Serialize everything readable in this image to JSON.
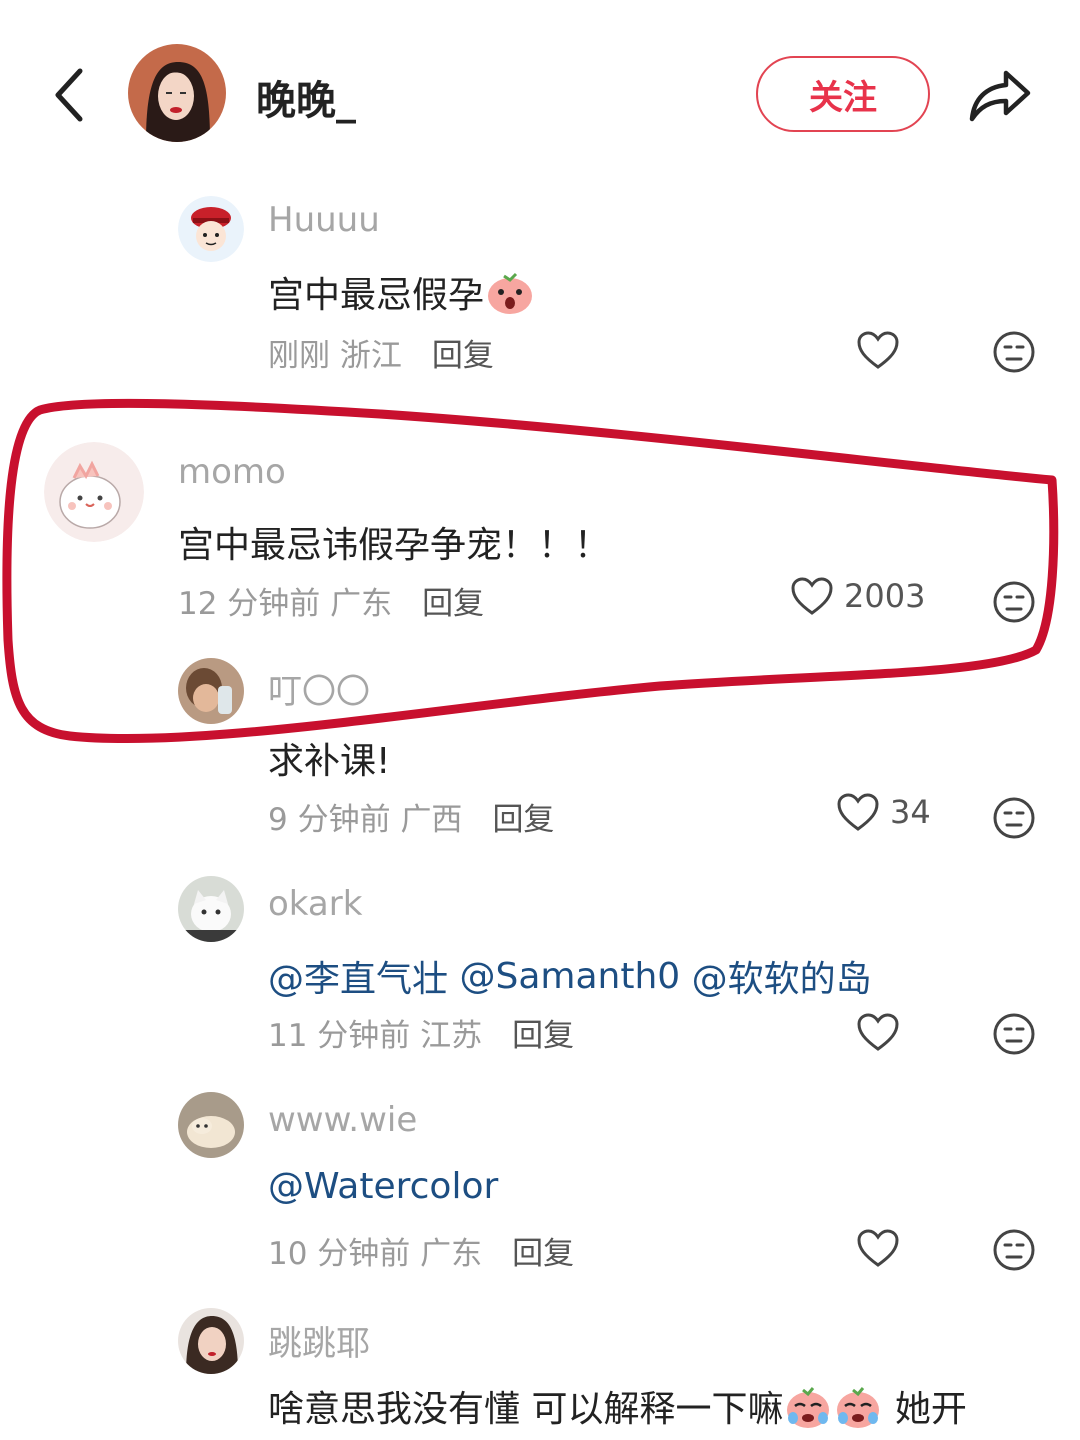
{
  "header": {
    "author_name": "晚晚_",
    "follow_label": "关注"
  },
  "comments": [
    {
      "user": "Huuuu",
      "text": "宫中最忌假孕",
      "time": "刚刚",
      "location": "浙江",
      "reply": "回复",
      "likes": ""
    },
    {
      "user": "momo",
      "text": "宫中最忌讳假孕争宠！！！",
      "time": "12 分钟前",
      "location": "广东",
      "reply": "回复",
      "likes": "2003"
    },
    {
      "user": "叮〇〇",
      "text": "求补课!",
      "time": "9 分钟前",
      "location": "广西",
      "reply": "回复",
      "likes": "34"
    },
    {
      "user": "okark",
      "mentions": [
        "@李直气壮",
        "@Samanth0",
        "@软软的岛"
      ],
      "time": "11 分钟前",
      "location": "江苏",
      "reply": "回复",
      "likes": ""
    },
    {
      "user": "www.wie",
      "mentions": [
        "@Watercolor"
      ],
      "time": "10 分钟前",
      "location": "广东",
      "reply": "回复",
      "likes": ""
    },
    {
      "user": "跳跳耶",
      "text_before": "啥意思我没有懂 可以解释一下嘛",
      "text_after": "她开"
    }
  ],
  "colors": {
    "accent_red": "#e8334b",
    "mention_blue": "#1d4e82",
    "annotation_red": "#c8102e"
  }
}
